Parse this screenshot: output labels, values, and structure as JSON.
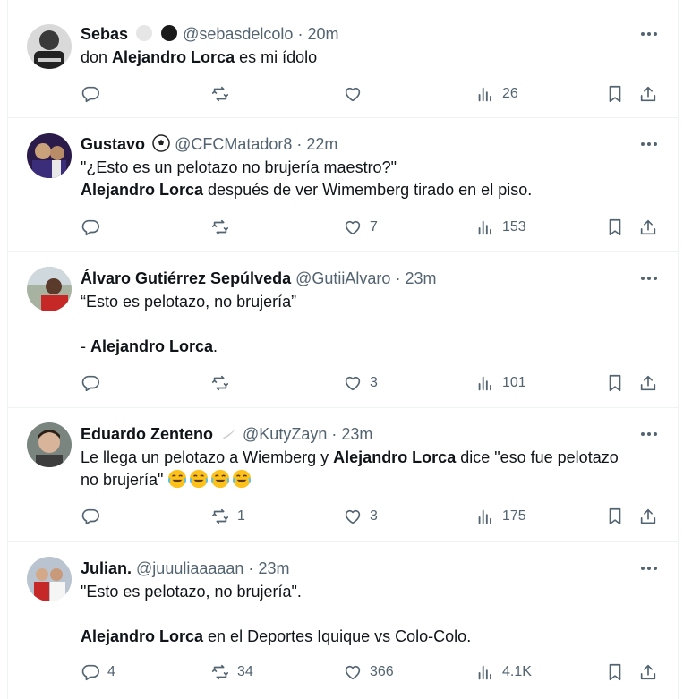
{
  "tweets": [
    {
      "name": "Sebas",
      "name_emoji": [
        "white-circle",
        "black-circle"
      ],
      "handle": "@sebasdelcolo",
      "time": "20m",
      "lines": [
        {
          "segments": [
            {
              "text": "don ",
              "bold": false
            },
            {
              "text": "Alejandro Lorca",
              "bold": true
            },
            {
              "text": " es mi ídolo",
              "bold": false
            }
          ]
        }
      ],
      "stats": {
        "replies": "",
        "retweets": "",
        "likes": "",
        "views": "26"
      }
    },
    {
      "name": "Gustavo",
      "name_emoji": [
        "soccer-ball"
      ],
      "handle": "@CFCMatador8",
      "time": "22m",
      "lines": [
        {
          "segments": [
            {
              "text": "\"¿Esto es un pelotazo no brujería maestro?\"",
              "bold": false
            }
          ]
        },
        {
          "segments": [
            {
              "text": "Alejandro Lorca",
              "bold": true
            },
            {
              "text": " después de ver Wimemberg tirado en el piso.",
              "bold": false
            }
          ]
        }
      ],
      "stats": {
        "replies": "",
        "retweets": "",
        "likes": "7",
        "views": "153"
      }
    },
    {
      "name": "Álvaro Gutiérrez Sepúlveda",
      "name_emoji": [],
      "handle": "@GutiiAlvaro",
      "time": "23m",
      "lines": [
        {
          "segments": [
            {
              "text": "“Esto es pelotazo, no brujería”",
              "bold": false
            }
          ]
        },
        {
          "segments": []
        },
        {
          "segments": [
            {
              "text": "- ",
              "bold": false
            },
            {
              "text": "Alejandro Lorca",
              "bold": true
            },
            {
              "text": ".",
              "bold": false
            }
          ]
        }
      ],
      "stats": {
        "replies": "",
        "retweets": "",
        "likes": "3",
        "views": "101"
      }
    },
    {
      "name": "Eduardo Zenteno",
      "name_emoji": [
        "feather"
      ],
      "handle": "@KutyZayn",
      "time": "23m",
      "lines": [
        {
          "segments": [
            {
              "text": "Le llega un pelotazo a Wiemberg y ",
              "bold": false
            },
            {
              "text": "Alejandro Lorca",
              "bold": true
            },
            {
              "text": " dice \"eso fue pelotazo",
              "bold": false
            }
          ]
        },
        {
          "segments": [
            {
              "text": "no brujería\" ",
              "bold": false
            },
            {
              "emoji": "laughing-crying",
              "count": 4
            }
          ]
        }
      ],
      "stats": {
        "replies": "",
        "retweets": "1",
        "likes": "3",
        "views": "175"
      }
    },
    {
      "name": "Julian.",
      "name_emoji": [],
      "handle": "@juuuliaaaaan",
      "time": "23m",
      "lines": [
        {
          "segments": [
            {
              "text": "\"Esto es pelotazo, no brujería\".",
              "bold": false
            }
          ]
        },
        {
          "segments": []
        },
        {
          "segments": [
            {
              "text": "Alejandro Lorca",
              "bold": true
            },
            {
              "text": " en el Deportes Iquique vs Colo-Colo.",
              "bold": false
            }
          ]
        }
      ],
      "stats": {
        "replies": "4",
        "retweets": "34",
        "likes": "366",
        "views": "4.1K"
      }
    }
  ],
  "ui": {
    "dot": "·",
    "icons": {
      "more": "more-icon",
      "reply": "reply-icon",
      "retweet": "retweet-icon",
      "like": "heart-icon",
      "views": "views-icon",
      "bookmark": "bookmark-icon",
      "share": "share-icon"
    },
    "colors": {
      "text": "#0f1419",
      "muted": "#536471",
      "border": "#eff3f4"
    }
  }
}
